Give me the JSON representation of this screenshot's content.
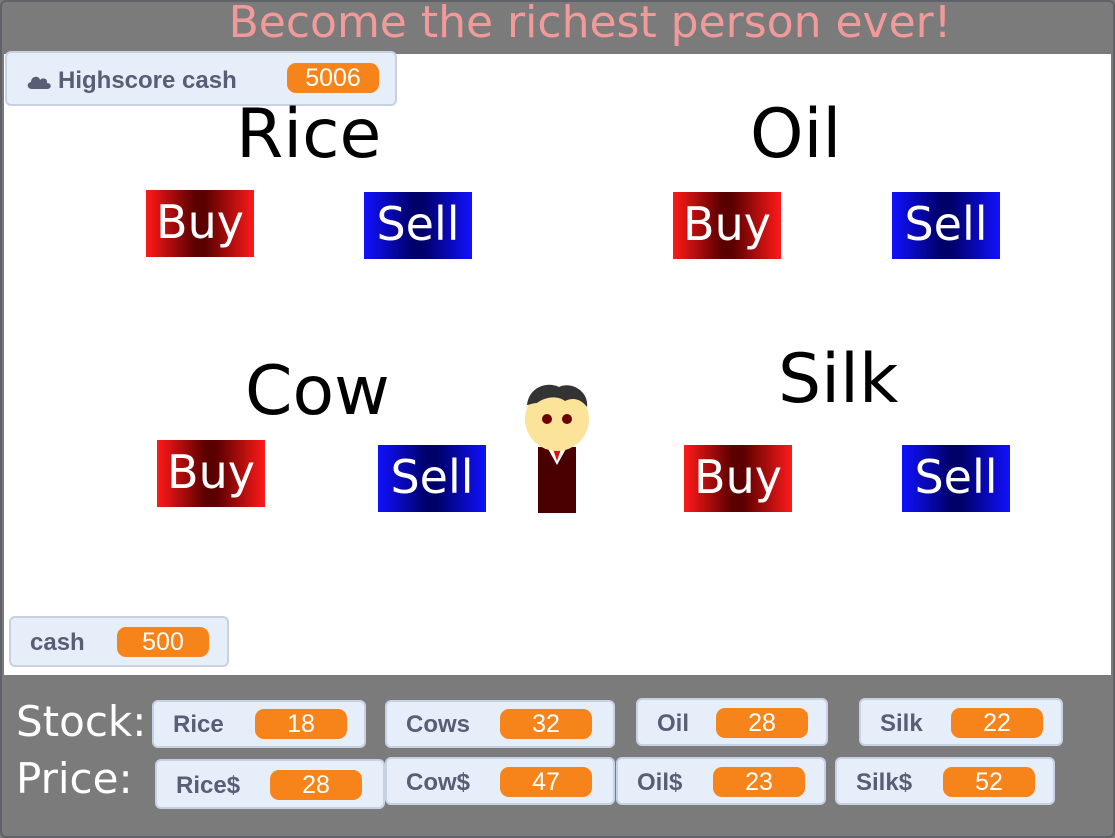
{
  "title": "Become the richest person ever!",
  "highscore": {
    "icon": "cloud-icon",
    "label": "Highscore cash",
    "value": "5006"
  },
  "cash": {
    "label": "cash",
    "value": "500"
  },
  "commodities": {
    "rice": {
      "name": "Rice",
      "buy": "Buy",
      "sell": "Sell"
    },
    "oil": {
      "name": "Oil",
      "buy": "Buy",
      "sell": "Sell"
    },
    "cow": {
      "name": "Cow",
      "buy": "Buy",
      "sell": "Sell"
    },
    "silk": {
      "name": "Silk",
      "buy": "Buy",
      "sell": "Sell"
    }
  },
  "stock": {
    "label": "Stock:",
    "items": [
      {
        "label": "Rice",
        "value": "18"
      },
      {
        "label": "Cows",
        "value": "32"
      },
      {
        "label": "Oil",
        "value": "28"
      },
      {
        "label": "Silk",
        "value": "22"
      }
    ]
  },
  "price": {
    "label": "Price:",
    "items": [
      {
        "label": "Rice$",
        "value": "28"
      },
      {
        "label": "Cow$",
        "value": "47"
      },
      {
        "label": "Oil$",
        "value": "23"
      },
      {
        "label": "Silk$",
        "value": "52"
      }
    ]
  },
  "colors": {
    "accent": "#f7841a",
    "title": "#f29a9a",
    "monitor_bg": "#e6eefa",
    "stage_bg": "#7b7b7b"
  }
}
